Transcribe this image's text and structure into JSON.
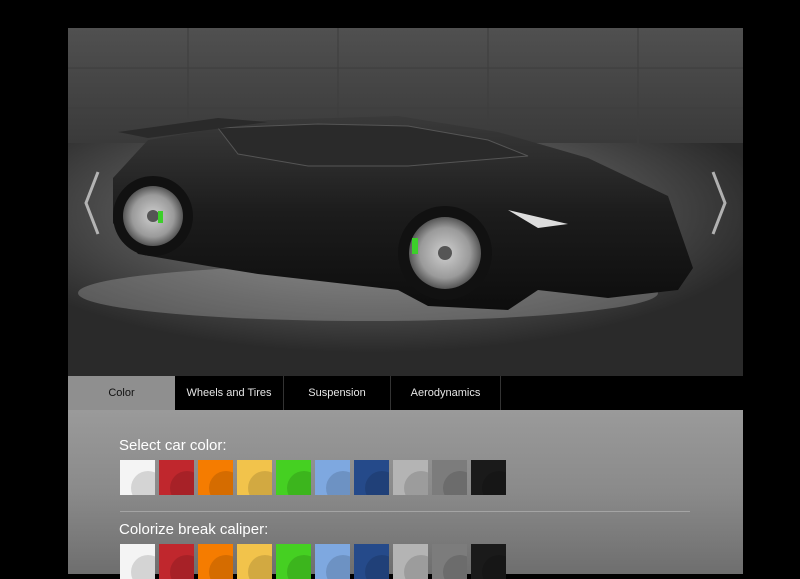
{
  "tabs": [
    {
      "label": "Color"
    },
    {
      "label": "Wheels and Tires"
    },
    {
      "label": "Suspension"
    },
    {
      "label": "Aerodynamics"
    }
  ],
  "active_tab": "Color",
  "sections": {
    "car_color": {
      "title": "Select car color:"
    },
    "caliper_color": {
      "title": "Colorize break caliper:"
    }
  },
  "swatch_colors": [
    "#f4f4f4",
    "#c0272d",
    "#f57c00",
    "#f2c34b",
    "#45d022",
    "#7ea8e0",
    "#254a8a",
    "#b4b4b4",
    "#7c7c7c",
    "#1a1a1a"
  ],
  "icons": {
    "prev": "chevron-left-icon",
    "next": "chevron-right-icon"
  }
}
